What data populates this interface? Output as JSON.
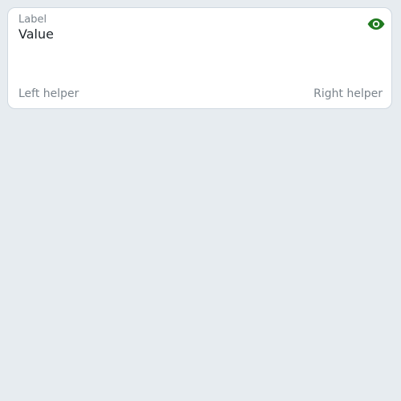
{
  "field": {
    "label": "Label",
    "value": "Value",
    "helper_left": "Left helper",
    "helper_right": "Right helper",
    "trailing_icon": "eye-icon"
  },
  "colors": {
    "background": "#e7ecf0",
    "card": "#ffffff",
    "border": "#cfd8e0",
    "text_primary": "#1e252b",
    "text_secondary": "#7b848c",
    "icon": "#1f7a1f"
  }
}
